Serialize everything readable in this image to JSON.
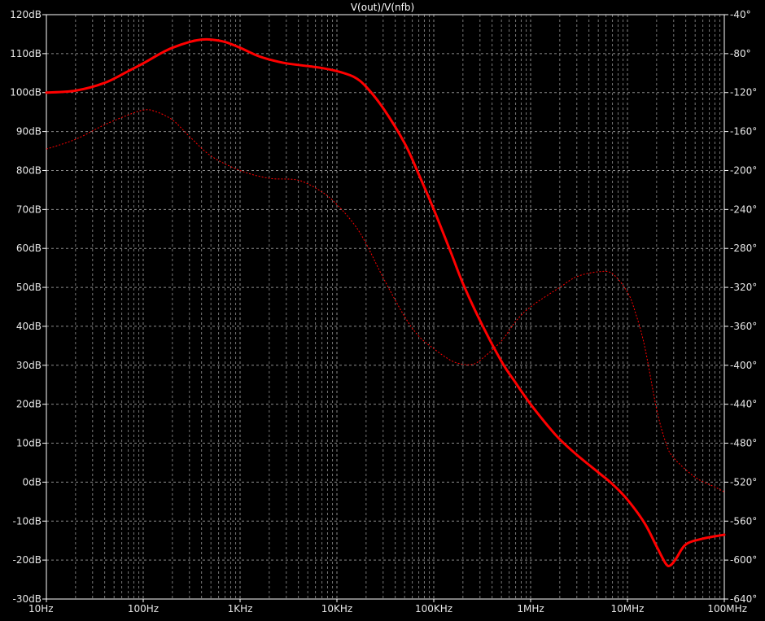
{
  "chart_data": {
    "type": "line",
    "title": "V(out)/V(nfb)",
    "x_scale": "log",
    "x_range_hz": [
      10,
      100000000
    ],
    "x_ticks": [
      {
        "value": 10,
        "label": "10Hz"
      },
      {
        "value": 100,
        "label": "100Hz"
      },
      {
        "value": 1000,
        "label": "1KHz"
      },
      {
        "value": 10000,
        "label": "10KHz"
      },
      {
        "value": 100000,
        "label": "100KHz"
      },
      {
        "value": 1000000,
        "label": "1MHz"
      },
      {
        "value": 10000000,
        "label": "10MHz"
      },
      {
        "value": 100000000,
        "label": "100MHz"
      }
    ],
    "y_left_range_db": [
      -30,
      120
    ],
    "y_left_ticks": [
      "120dB",
      "110dB",
      "100dB",
      "90dB",
      "80dB",
      "70dB",
      "60dB",
      "50dB",
      "40dB",
      "30dB",
      "20dB",
      "10dB",
      "0dB",
      "-10dB",
      "-20dB",
      "-30dB"
    ],
    "y_right_range_deg": [
      -640,
      -40
    ],
    "y_right_ticks": [
      "-40°",
      "-80°",
      "-120°",
      "-160°",
      "-200°",
      "-240°",
      "-280°",
      "-320°",
      "-360°",
      "-400°",
      "-440°",
      "-480°",
      "-520°",
      "-560°",
      "-600°",
      "-640°"
    ],
    "grid": true,
    "background_color": "#000000",
    "grid_color": "#8c8c8c",
    "trace_color": "#ff0000",
    "series": [
      {
        "kind": "magnitude_db",
        "axis": "left",
        "points": [
          [
            10,
            100.0
          ],
          [
            20,
            100.5
          ],
          [
            40,
            102.5
          ],
          [
            70,
            105.5
          ],
          [
            100,
            107.5
          ],
          [
            150,
            110.0
          ],
          [
            200,
            111.5
          ],
          [
            300,
            113.0
          ],
          [
            400,
            113.6
          ],
          [
            500,
            113.6
          ],
          [
            700,
            113.0
          ],
          [
            1000,
            111.5
          ],
          [
            1500,
            109.5
          ],
          [
            2000,
            108.5
          ],
          [
            3000,
            107.5
          ],
          [
            5000,
            106.8
          ],
          [
            7000,
            106.3
          ],
          [
            10000,
            105.5
          ],
          [
            15000,
            104.0
          ],
          [
            20000,
            101.5
          ],
          [
            30000,
            96.0
          ],
          [
            50000,
            87.0
          ],
          [
            70000,
            79.0
          ],
          [
            100000,
            70.0
          ],
          [
            150000,
            59.0
          ],
          [
            200000,
            51.0
          ],
          [
            300000,
            41.5
          ],
          [
            500000,
            31.0
          ],
          [
            700000,
            25.5
          ],
          [
            1000000,
            20.0
          ],
          [
            1500000,
            14.5
          ],
          [
            2000000,
            11.0
          ],
          [
            3000000,
            7.0
          ],
          [
            5000000,
            2.5
          ],
          [
            7000000,
            -0.5
          ],
          [
            10000000,
            -4.5
          ],
          [
            15000000,
            -10.5
          ],
          [
            20000000,
            -16.5
          ],
          [
            25000000,
            -21.0
          ],
          [
            28000000,
            -21.3
          ],
          [
            32000000,
            -19.5
          ],
          [
            40000000,
            -16.0
          ],
          [
            60000000,
            -14.5
          ],
          [
            100000000,
            -13.5
          ]
        ]
      },
      {
        "kind": "phase_deg",
        "axis": "right",
        "points": [
          [
            10,
            -178
          ],
          [
            20,
            -168
          ],
          [
            40,
            -153
          ],
          [
            70,
            -143
          ],
          [
            100,
            -138
          ],
          [
            130,
            -139
          ],
          [
            200,
            -148
          ],
          [
            300,
            -165
          ],
          [
            500,
            -185
          ],
          [
            1000,
            -200
          ],
          [
            2000,
            -208
          ],
          [
            4000,
            -210
          ],
          [
            7000,
            -222
          ],
          [
            10000,
            -235
          ],
          [
            15000,
            -255
          ],
          [
            20000,
            -275
          ],
          [
            30000,
            -310
          ],
          [
            50000,
            -350
          ],
          [
            70000,
            -370
          ],
          [
            100000,
            -383
          ],
          [
            150000,
            -395
          ],
          [
            200000,
            -399
          ],
          [
            250000,
            -399
          ],
          [
            300000,
            -395
          ],
          [
            500000,
            -375
          ],
          [
            700000,
            -355
          ],
          [
            1000000,
            -340
          ],
          [
            2000000,
            -320
          ],
          [
            3000000,
            -309
          ],
          [
            5000000,
            -304
          ],
          [
            7000000,
            -306
          ],
          [
            10000000,
            -325
          ],
          [
            12000000,
            -345
          ],
          [
            15000000,
            -380
          ],
          [
            20000000,
            -445
          ],
          [
            25000000,
            -480
          ],
          [
            30000000,
            -495
          ],
          [
            50000000,
            -515
          ],
          [
            80000000,
            -525
          ],
          [
            100000000,
            -530
          ]
        ]
      }
    ]
  }
}
